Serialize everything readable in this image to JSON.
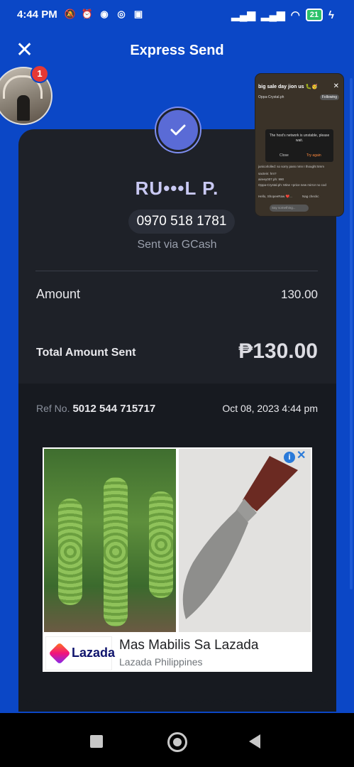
{
  "status_bar": {
    "time": "4:44 PM",
    "battery": "21"
  },
  "header": {
    "title": "Express Send",
    "close_icon": "close-icon"
  },
  "avatar": {
    "badge_count": "1"
  },
  "receipt": {
    "recipient_name": "RU•••L P.",
    "phone": "0970 518 1781",
    "sent_via": "Sent via GCash",
    "amount_label": "Amount",
    "amount_value": "130.00",
    "total_label": "Total Amount Sent",
    "total_value": "₱130.00",
    "ref_label": "Ref No.",
    "ref_number": "5012 544 715717",
    "date": "Oct 08, 2023 4:44 pm"
  },
  "ad": {
    "headline": "Mas Mabilis Sa Lazada",
    "advertiser": "Lazada Philippines",
    "logo_text": "Lazada",
    "info_icon": "info-icon",
    "close_icon": "close-icon"
  },
  "pip": {
    "title": "big sale day jion us 🐛🥳",
    "host": "Oppa-Crystal.ph",
    "follow_label": "Following",
    "dialog_message": "The host's network is unstable, please wait.",
    "dialog_close": "Close",
    "dialog_retry": "Try again",
    "chat_1": "junicorlolled: so sorry pass nmn I thought 5mm",
    "chat_2": "sactein: hm?",
    "chat_3": "aireey007.ph: 990",
    "chat_4": "Oppa-Crystal.ph: Mine +price new mirror no cod",
    "chat_5": "Hello, ShopeeRaw ❤️...",
    "chat_6": "Nag checkc",
    "input_placeholder": "Say something..."
  },
  "colors": {
    "background": "#0b47c6",
    "card": "#1e2128",
    "accent": "#5a6bd6"
  }
}
